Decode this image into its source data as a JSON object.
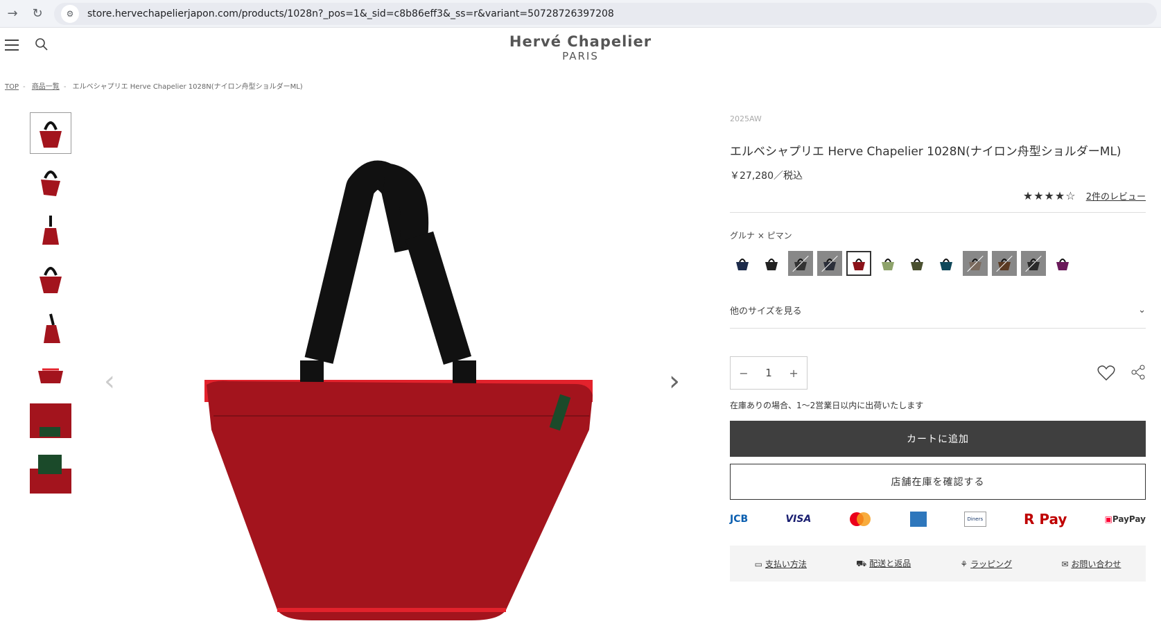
{
  "browser": {
    "url": "store.hervechapelierjapon.com/products/1028n?_pos=1&_sid=c8b86eff3&_ss=r&variant=50728726397208"
  },
  "header": {
    "logo_line1": "Hervé Chapelier",
    "logo_line2": "PARIS"
  },
  "breadcrumb": {
    "items": [
      "TOP",
      "商品一覧",
      "エルベシャプリエ Herve Chapelier 1028N(ナイロン舟型ショルダーML)"
    ]
  },
  "product": {
    "season": "2025AW",
    "title": "エルベシャプリエ Herve Chapelier 1028N(ナイロン舟型ショルダーML)",
    "price": "￥27,280／税込",
    "rating_stars": "★★★★☆",
    "review_link": "2件のレビュー",
    "color_name": "グルナ × ピマン",
    "other_sizes": "他のサイズを見る",
    "quantity": "1",
    "shipping_note": "在庫ありの場合、1〜2営業日以内に出荷いたします",
    "add_to_cart": "カートに追加",
    "check_store": "店舗在庫を確認する"
  },
  "swatches": [
    {
      "color": "#1d2b4a",
      "soldout": false
    },
    {
      "color": "#222222",
      "soldout": false
    },
    {
      "color": "#333333",
      "soldout": true
    },
    {
      "color": "#2b2f3a",
      "soldout": true
    },
    {
      "color": "#8b1219",
      "soldout": false,
      "selected": true
    },
    {
      "color": "#8ea36b",
      "soldout": false
    },
    {
      "color": "#4a5030",
      "soldout": false
    },
    {
      "color": "#10485a",
      "soldout": false
    },
    {
      "color": "#7a6a5e",
      "soldout": true
    },
    {
      "color": "#5a3a22",
      "soldout": true
    },
    {
      "color": "#2a2a2a",
      "soldout": true
    },
    {
      "color": "#6a1a5a",
      "soldout": false
    }
  ],
  "payments": [
    "JCB",
    "VISA",
    "Mastercard",
    "AMEX",
    "Diners Club",
    "R Pay",
    "PayPay"
  ],
  "info": {
    "payment": "支払い方法",
    "delivery": "配送と返品",
    "wrapping": "ラッピング",
    "contact": "お問い合わせ"
  },
  "colors": {
    "bag_body": "#a3141d",
    "bag_inner": "#e3222c",
    "handle": "#111111",
    "cart_btn": "#3f3f3f"
  }
}
